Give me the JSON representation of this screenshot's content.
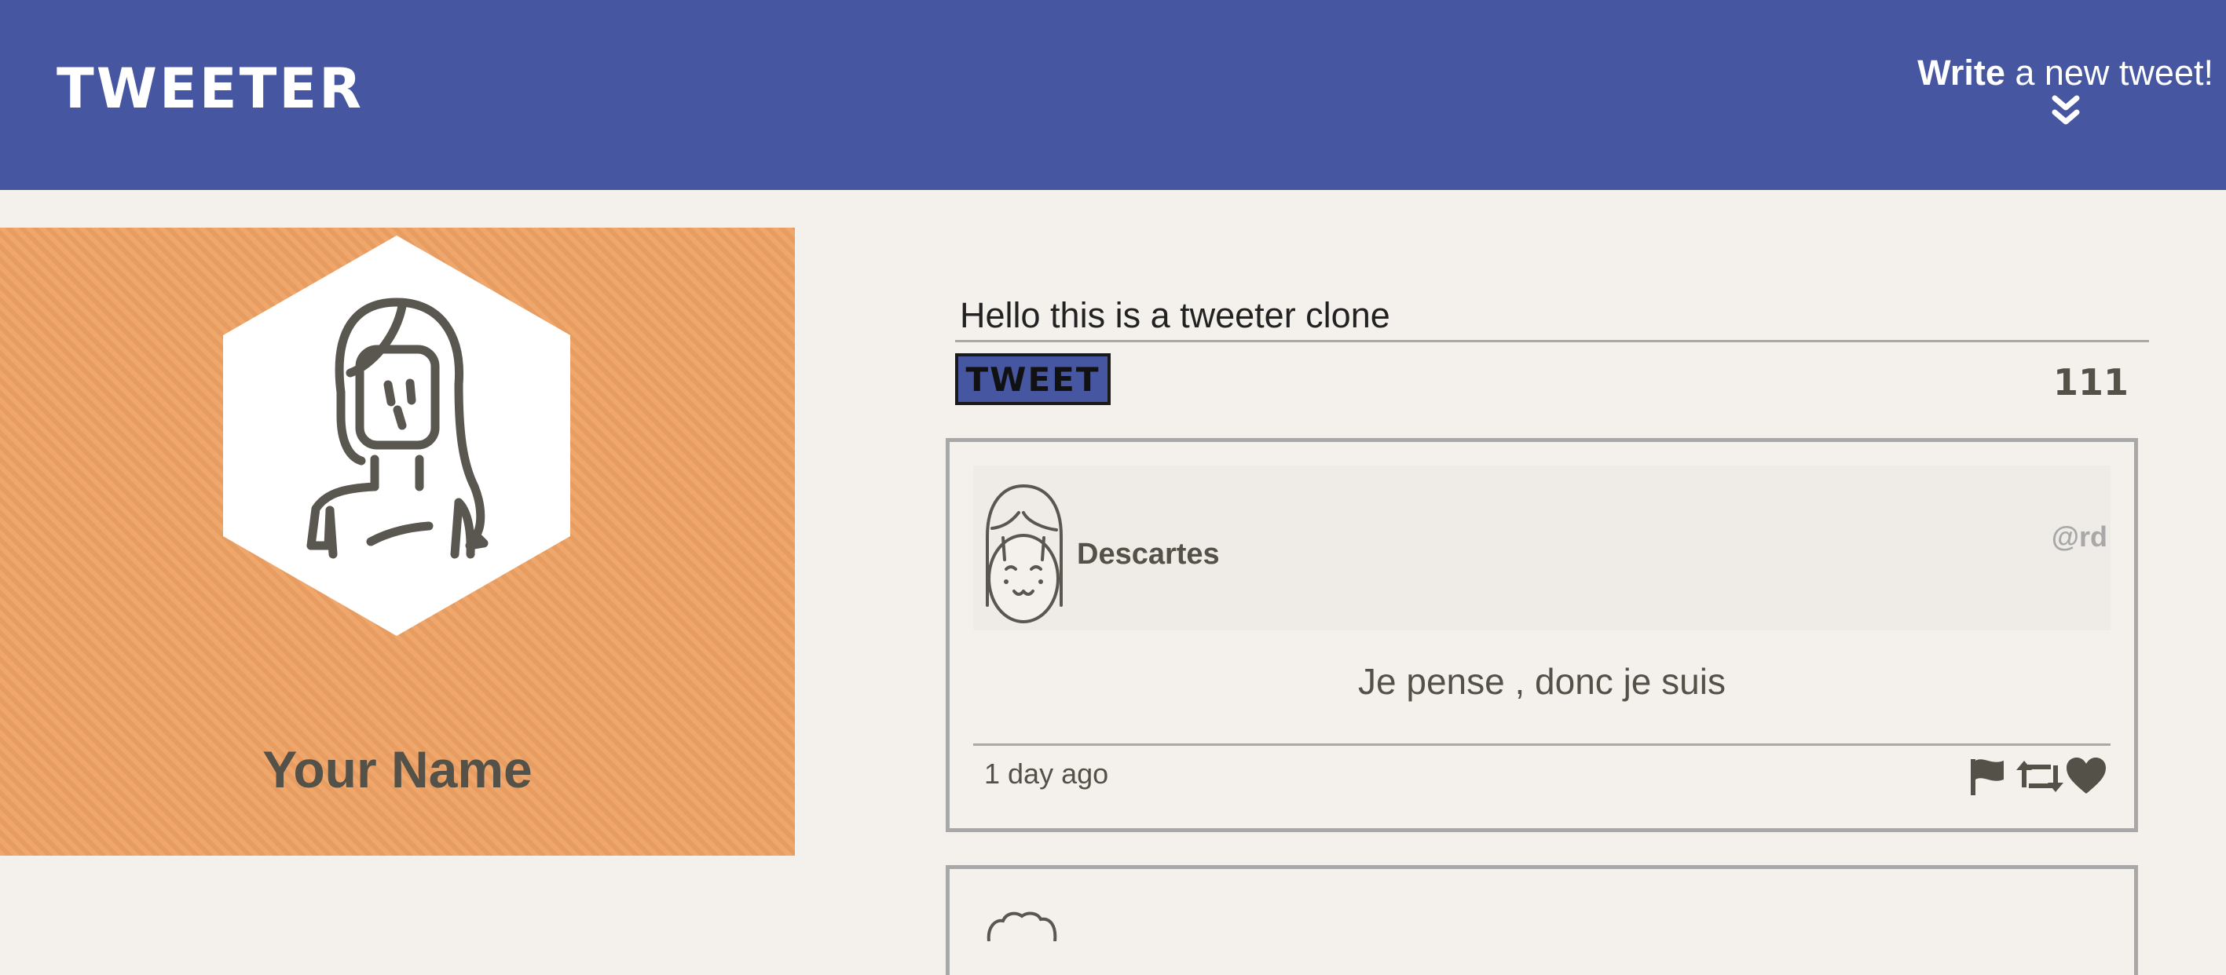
{
  "nav": {
    "brand": "TWEETER",
    "compose_bold": "Write",
    "compose_rest": " a new tweet!",
    "compose_icon": "double-chevron-down-icon"
  },
  "colors": {
    "nav": "#4656a0",
    "profile_bg": "#eea264",
    "page_bg": "#f4f1ec",
    "text": "#545149",
    "muted": "#a8a8a8"
  },
  "profile": {
    "avatar_icon": "woman-avatar-icon",
    "name": "Your Name"
  },
  "composer": {
    "value": "Hello this is a tweeter clone",
    "button_label": "TWEET",
    "counter": "111"
  },
  "tweets": [
    {
      "avatar_icon": "girl-avatar-icon",
      "user": "Descartes",
      "handle": "@rd",
      "text": "Je pense , donc je suis",
      "time": "1 day ago",
      "actions": [
        "flag-icon",
        "retweet-icon",
        "heart-icon"
      ]
    }
  ]
}
